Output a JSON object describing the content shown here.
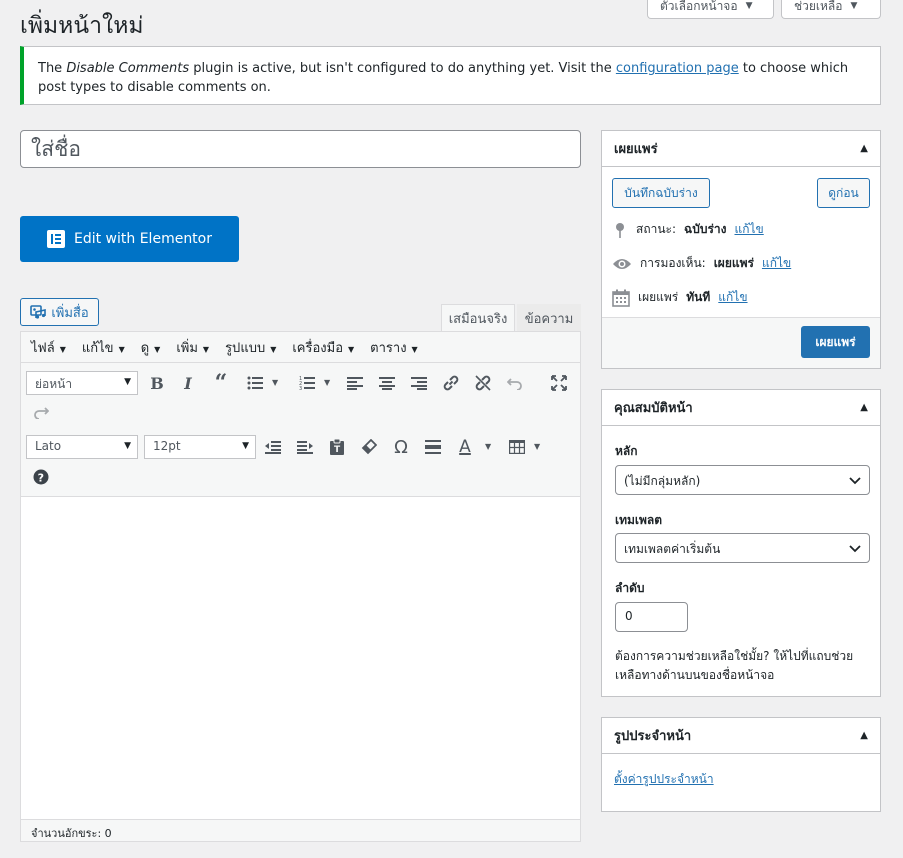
{
  "screen_tabs": {
    "options_label": "ตัวเลือกหน้าจอ",
    "help_label": "ช่วยเหลือ"
  },
  "page_title": "เพิ่มหน้าใหม่",
  "notice": {
    "prefix": "The ",
    "plugin_name": "Disable Comments",
    "middle": " plugin is active, but isn't configured to do anything yet. Visit the ",
    "link_text": "configuration page",
    "suffix": " to choose which post types to disable comments on."
  },
  "title_placeholder": "ใส่ชื่อ",
  "elementor_button": "Edit with Elementor",
  "add_media_button": "เพิ่มสื่อ",
  "editor_tabs": {
    "visual": "เสมือนจริง",
    "text": "ข้อความ"
  },
  "editor_menu": [
    "ไฟล์",
    "แก้ไข",
    "ดู",
    "เพิ่ม",
    "รูปแบบ",
    "เครื่องมือ",
    "ตาราง"
  ],
  "toolbar": {
    "format_select": "ย่อหน้า",
    "font_family_select": "Lato",
    "font_size_select": "12pt"
  },
  "status_bar": "จำนวนอักขระ: 0",
  "publish_box": {
    "title": "เผยแพร่",
    "save_draft": "บันทึกฉบับร่าง",
    "preview": "ดูก่อน",
    "status_label": "สถานะ:",
    "status_value": "ฉบับร่าง",
    "visibility_label": "การมองเห็น:",
    "visibility_value": "เผยแพร่",
    "publish_label": "เผยแพร่",
    "publish_value": "ทันที",
    "edit_link": "แก้ไข",
    "publish_button": "เผยแพร่"
  },
  "page_attributes": {
    "title": "คุณสมบัติหน้า",
    "parent_label": "หลัก",
    "parent_value": "(ไม่มีกลุ่มหลัก)",
    "template_label": "เทมเพลต",
    "template_value": "เทมเพลตค่าเริ่มต้น",
    "order_label": "ลำดับ",
    "order_value": "0",
    "help_text": "ต้องการความช่วยเหลือใช่มั้ย? ให้ไปที่แถบช่วยเหลือทางด้านบนของชื่อหน้าจอ"
  },
  "featured_image": {
    "title": "รูปประจำหน้า",
    "set_link": "ตั้งค่ารูปประจำหน้า"
  },
  "colors": {
    "primary": "#2271b1",
    "elementor": "#0073c6",
    "notice_success": "#00a32a"
  }
}
